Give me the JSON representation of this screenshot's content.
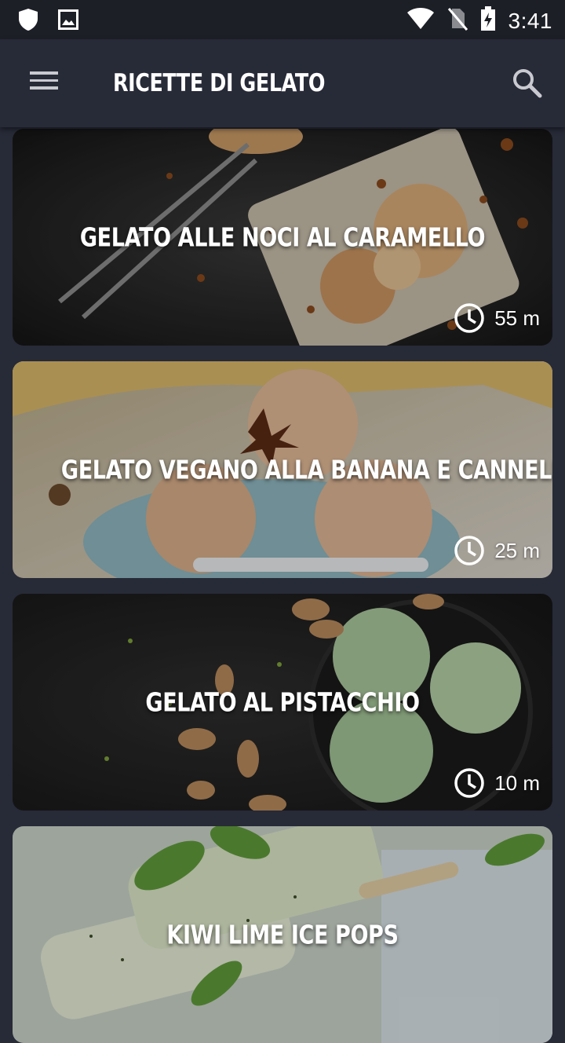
{
  "status_bar": {
    "time": "3:41",
    "left_icons": [
      "shield-icon",
      "image-icon"
    ],
    "right_icons": [
      "wifi-icon",
      "no-sim-icon",
      "battery-charging-icon"
    ]
  },
  "app_bar": {
    "title": "RICETTE DI GELATO",
    "menu_icon": "hamburger-menu-icon",
    "search_icon": "search-icon"
  },
  "recipes": [
    {
      "title": "GELATO ALLE NOCI AL CARAMELLO",
      "time": "55 m"
    },
    {
      "title": "GELATO VEGANO ALLA BANANA E CANNELLA",
      "time": "25 m"
    },
    {
      "title": "GELATO AL PISTACCHIO",
      "time": "10 m"
    },
    {
      "title": "KIWI LIME ICE POPS",
      "time": ""
    }
  ],
  "colors": {
    "background": "#272a37",
    "status_bar": "#1d1f27",
    "text": "#ffffff"
  }
}
